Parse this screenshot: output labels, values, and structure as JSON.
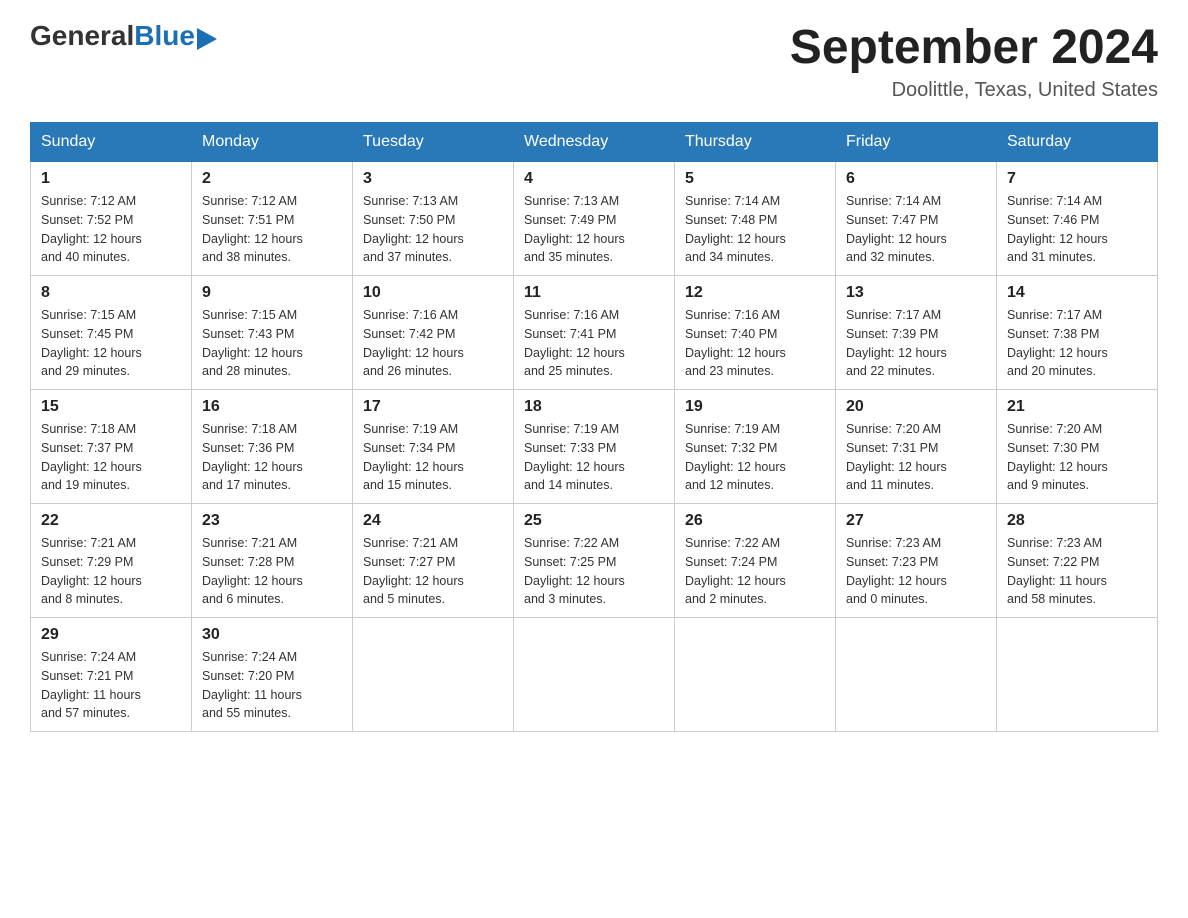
{
  "header": {
    "logo_general": "General",
    "logo_blue": "Blue",
    "month_title": "September 2024",
    "location": "Doolittle, Texas, United States"
  },
  "days_of_week": [
    "Sunday",
    "Monday",
    "Tuesday",
    "Wednesday",
    "Thursday",
    "Friday",
    "Saturday"
  ],
  "weeks": [
    [
      {
        "day": "1",
        "sunrise": "7:12 AM",
        "sunset": "7:52 PM",
        "daylight": "12 hours and 40 minutes."
      },
      {
        "day": "2",
        "sunrise": "7:12 AM",
        "sunset": "7:51 PM",
        "daylight": "12 hours and 38 minutes."
      },
      {
        "day": "3",
        "sunrise": "7:13 AM",
        "sunset": "7:50 PM",
        "daylight": "12 hours and 37 minutes."
      },
      {
        "day": "4",
        "sunrise": "7:13 AM",
        "sunset": "7:49 PM",
        "daylight": "12 hours and 35 minutes."
      },
      {
        "day": "5",
        "sunrise": "7:14 AM",
        "sunset": "7:48 PM",
        "daylight": "12 hours and 34 minutes."
      },
      {
        "day": "6",
        "sunrise": "7:14 AM",
        "sunset": "7:47 PM",
        "daylight": "12 hours and 32 minutes."
      },
      {
        "day": "7",
        "sunrise": "7:14 AM",
        "sunset": "7:46 PM",
        "daylight": "12 hours and 31 minutes."
      }
    ],
    [
      {
        "day": "8",
        "sunrise": "7:15 AM",
        "sunset": "7:45 PM",
        "daylight": "12 hours and 29 minutes."
      },
      {
        "day": "9",
        "sunrise": "7:15 AM",
        "sunset": "7:43 PM",
        "daylight": "12 hours and 28 minutes."
      },
      {
        "day": "10",
        "sunrise": "7:16 AM",
        "sunset": "7:42 PM",
        "daylight": "12 hours and 26 minutes."
      },
      {
        "day": "11",
        "sunrise": "7:16 AM",
        "sunset": "7:41 PM",
        "daylight": "12 hours and 25 minutes."
      },
      {
        "day": "12",
        "sunrise": "7:16 AM",
        "sunset": "7:40 PM",
        "daylight": "12 hours and 23 minutes."
      },
      {
        "day": "13",
        "sunrise": "7:17 AM",
        "sunset": "7:39 PM",
        "daylight": "12 hours and 22 minutes."
      },
      {
        "day": "14",
        "sunrise": "7:17 AM",
        "sunset": "7:38 PM",
        "daylight": "12 hours and 20 minutes."
      }
    ],
    [
      {
        "day": "15",
        "sunrise": "7:18 AM",
        "sunset": "7:37 PM",
        "daylight": "12 hours and 19 minutes."
      },
      {
        "day": "16",
        "sunrise": "7:18 AM",
        "sunset": "7:36 PM",
        "daylight": "12 hours and 17 minutes."
      },
      {
        "day": "17",
        "sunrise": "7:19 AM",
        "sunset": "7:34 PM",
        "daylight": "12 hours and 15 minutes."
      },
      {
        "day": "18",
        "sunrise": "7:19 AM",
        "sunset": "7:33 PM",
        "daylight": "12 hours and 14 minutes."
      },
      {
        "day": "19",
        "sunrise": "7:19 AM",
        "sunset": "7:32 PM",
        "daylight": "12 hours and 12 minutes."
      },
      {
        "day": "20",
        "sunrise": "7:20 AM",
        "sunset": "7:31 PM",
        "daylight": "12 hours and 11 minutes."
      },
      {
        "day": "21",
        "sunrise": "7:20 AM",
        "sunset": "7:30 PM",
        "daylight": "12 hours and 9 minutes."
      }
    ],
    [
      {
        "day": "22",
        "sunrise": "7:21 AM",
        "sunset": "7:29 PM",
        "daylight": "12 hours and 8 minutes."
      },
      {
        "day": "23",
        "sunrise": "7:21 AM",
        "sunset": "7:28 PM",
        "daylight": "12 hours and 6 minutes."
      },
      {
        "day": "24",
        "sunrise": "7:21 AM",
        "sunset": "7:27 PM",
        "daylight": "12 hours and 5 minutes."
      },
      {
        "day": "25",
        "sunrise": "7:22 AM",
        "sunset": "7:25 PM",
        "daylight": "12 hours and 3 minutes."
      },
      {
        "day": "26",
        "sunrise": "7:22 AM",
        "sunset": "7:24 PM",
        "daylight": "12 hours and 2 minutes."
      },
      {
        "day": "27",
        "sunrise": "7:23 AM",
        "sunset": "7:23 PM",
        "daylight": "12 hours and 0 minutes."
      },
      {
        "day": "28",
        "sunrise": "7:23 AM",
        "sunset": "7:22 PM",
        "daylight": "11 hours and 58 minutes."
      }
    ],
    [
      {
        "day": "29",
        "sunrise": "7:24 AM",
        "sunset": "7:21 PM",
        "daylight": "11 hours and 57 minutes."
      },
      {
        "day": "30",
        "sunrise": "7:24 AM",
        "sunset": "7:20 PM",
        "daylight": "11 hours and 55 minutes."
      },
      null,
      null,
      null,
      null,
      null
    ]
  ],
  "labels": {
    "sunrise_label": "Sunrise:",
    "sunset_label": "Sunset:",
    "daylight_label": "Daylight:"
  }
}
